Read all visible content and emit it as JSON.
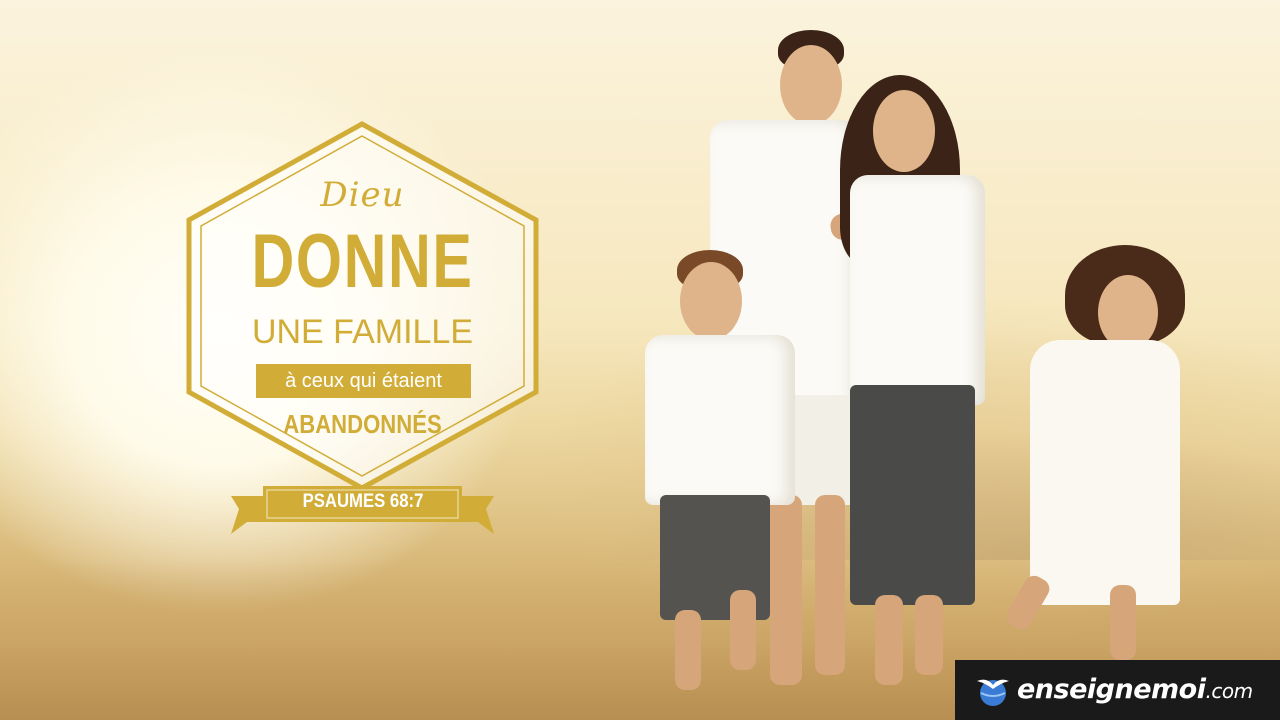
{
  "verse": {
    "line1": "Dieu",
    "line2": "DONNE",
    "line3": "UNE FAMILLE",
    "line4": "à ceux qui étaient",
    "line5": "ABANDONNÉS",
    "reference": "PSAUMES 68:7"
  },
  "logo": {
    "name": "enseignemoi",
    "domain": ".com",
    "icon": "bird-globe-icon"
  },
  "colors": {
    "gold": "#d1ad38",
    "logo_bg": "#1a1a1a",
    "white": "#ffffff"
  },
  "photo": {
    "subject": "family of four walking on a sunlit beach"
  }
}
